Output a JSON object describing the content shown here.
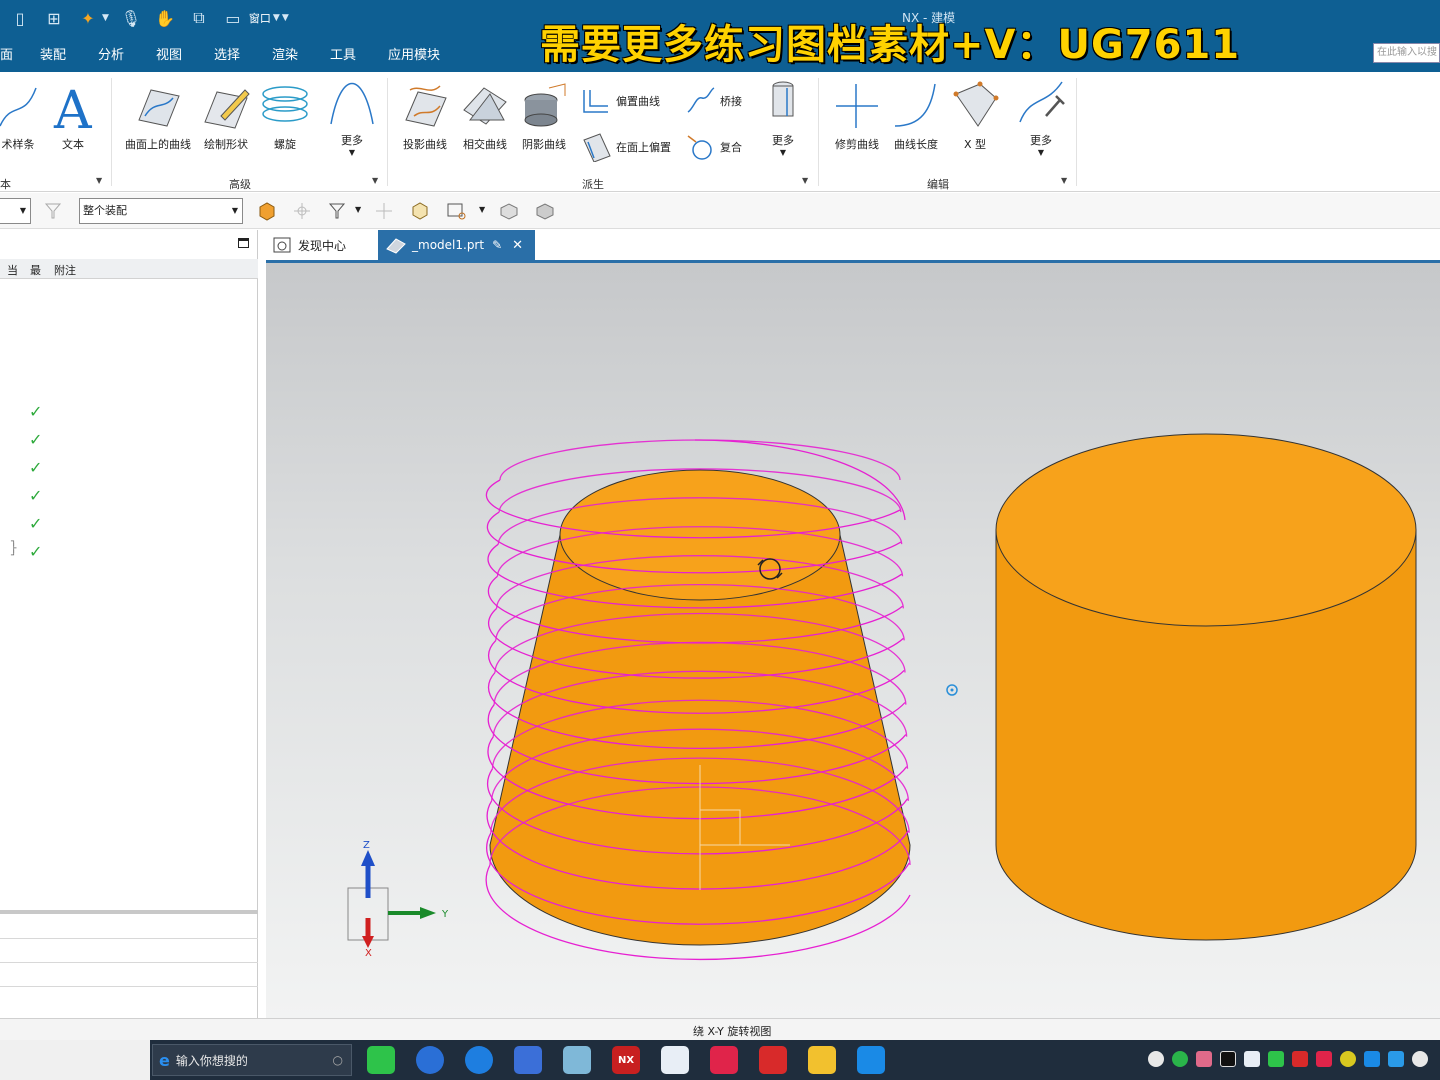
{
  "window": {
    "app_title": "NX - 建模",
    "watermark": "需要更多练习图档素材+V：UG7611",
    "quick_access": {
      "window_menu": "窗口"
    },
    "menu": [
      "面",
      "装配",
      "分析",
      "视图",
      "选择",
      "渲染",
      "工具",
      "应用模块"
    ],
    "command_search_placeholder": "在此输入以搜"
  },
  "ribbon": {
    "group_curve": {
      "label": "本",
      "buttons": {
        "art_spline": "术样条",
        "text": "文本"
      }
    },
    "group_advanced": {
      "label": "高级",
      "buttons": {
        "curve_on_surface": "曲面上的曲线",
        "sketch_shape": "绘制形状",
        "helix": "螺旋",
        "more": "更多"
      }
    },
    "group_derived": {
      "label": "派生",
      "buttons": {
        "project_curve": "投影曲线",
        "intersect_curve": "相交曲线",
        "shadow_curve": "阴影曲线",
        "offset_curve": "偏置曲线",
        "offset_on_face": "在面上偏置",
        "bridge": "桥接",
        "composite": "复合",
        "more": "更多"
      }
    },
    "group_edit": {
      "label": "编辑",
      "buttons": {
        "trim_curve": "修剪曲线",
        "curve_length": "曲线长度",
        "x_form": "X 型",
        "more": "更多"
      }
    }
  },
  "selection_bar": {
    "scope_value": "整个装配"
  },
  "navigator": {
    "columns": [
      "当",
      "最",
      "附注"
    ],
    "checked_rows": 6
  },
  "tabs": [
    {
      "label": "发现中心",
      "active": false
    },
    {
      "label": "_model1.prt",
      "active": true
    }
  ],
  "viewport": {
    "triad": {
      "z": "Z",
      "y": "Y",
      "x": "X"
    },
    "colors": {
      "solid": "#f7a21b",
      "helix": "#e620d2",
      "background_top": "#c6c8ca"
    }
  },
  "status": {
    "message": "绕 X-Y 旋转视图"
  },
  "taskbar": {
    "search_placeholder": "输入你想搜的",
    "apps": [
      "wechat-icon",
      "sync-icon",
      "k-app-icon",
      "pen-app-icon",
      "paper-app-icon",
      "nx-icon",
      "cloud-icon",
      "red-app-icon",
      "red-figure-icon",
      "folder-icon",
      "blue-app-icon"
    ],
    "tray": [
      "bell-icon",
      "play-icon",
      "flower-icon",
      "tiktok-icon",
      "network-icon",
      "wechat-icon",
      "red-icon",
      "red2-icon",
      "plus-icon",
      "blue-icon",
      "upload-icon",
      "mic-icon",
      "monitor-icon"
    ]
  }
}
